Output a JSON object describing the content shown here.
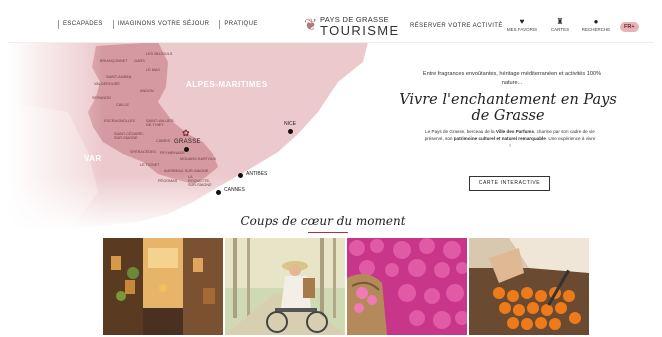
{
  "header": {
    "nav": [
      "Escapades",
      "Imaginons votre séjour",
      "Pratique"
    ],
    "logo_line1": "Pays de Grasse",
    "logo_line2": "Tourisme",
    "reserve_label": "Réserver votre activité",
    "favoris_label": "Mes favoris",
    "cartes_label": "Cartes",
    "recherche_label": "Recherche",
    "lang_label": "FR+"
  },
  "map": {
    "regions": {
      "alpes": "ALPES-MARITIMES",
      "var": "VAR"
    },
    "towns": [
      "Les Mujouls",
      "Briançonnet",
      "Gars",
      "Le Mas",
      "Saint-Auban",
      "Valderoure",
      "Andon",
      "Séranon",
      "Caille",
      "Escragnolles",
      "Saint-Vallier-de-Thiey",
      "Saint-Cézaire-sur-Siagne",
      "Cabris",
      "Spéracèdes",
      "Peymeinade",
      "Mouans-Sartoux",
      "Le Tignet",
      "Auribeau-sur-Siagne",
      "La Roquette-sur-Siagne",
      "Pégomas"
    ],
    "grasse_label": "Grasse",
    "cities": {
      "nice": "Nice",
      "antibes": "Antibes",
      "cannes": "Cannes"
    }
  },
  "intro_text": "Entre fragrances envoûtantes, héritage méditerranéen et activités 100% nature...",
  "main_title": "Vivre l'enchantement en Pays de Grasse",
  "description": {
    "part1": "Le Pays de Grasse, berceau de la ",
    "bold1": "Ville des Parfums",
    "part2": ", charme par son cadre de vie préservé, son ",
    "bold2": "patrimoine culturel et naturel remarquable",
    "part3": ". Une expérience à vivre !"
  },
  "cta_label": "Carte interactive",
  "coups_title": "Coups de cœur du moment",
  "colors": {
    "map_pink": "#e3b5ba",
    "map_dark": "#d59aa1",
    "accent": "#b0303a",
    "lang_bg": "#e7b3b8"
  }
}
